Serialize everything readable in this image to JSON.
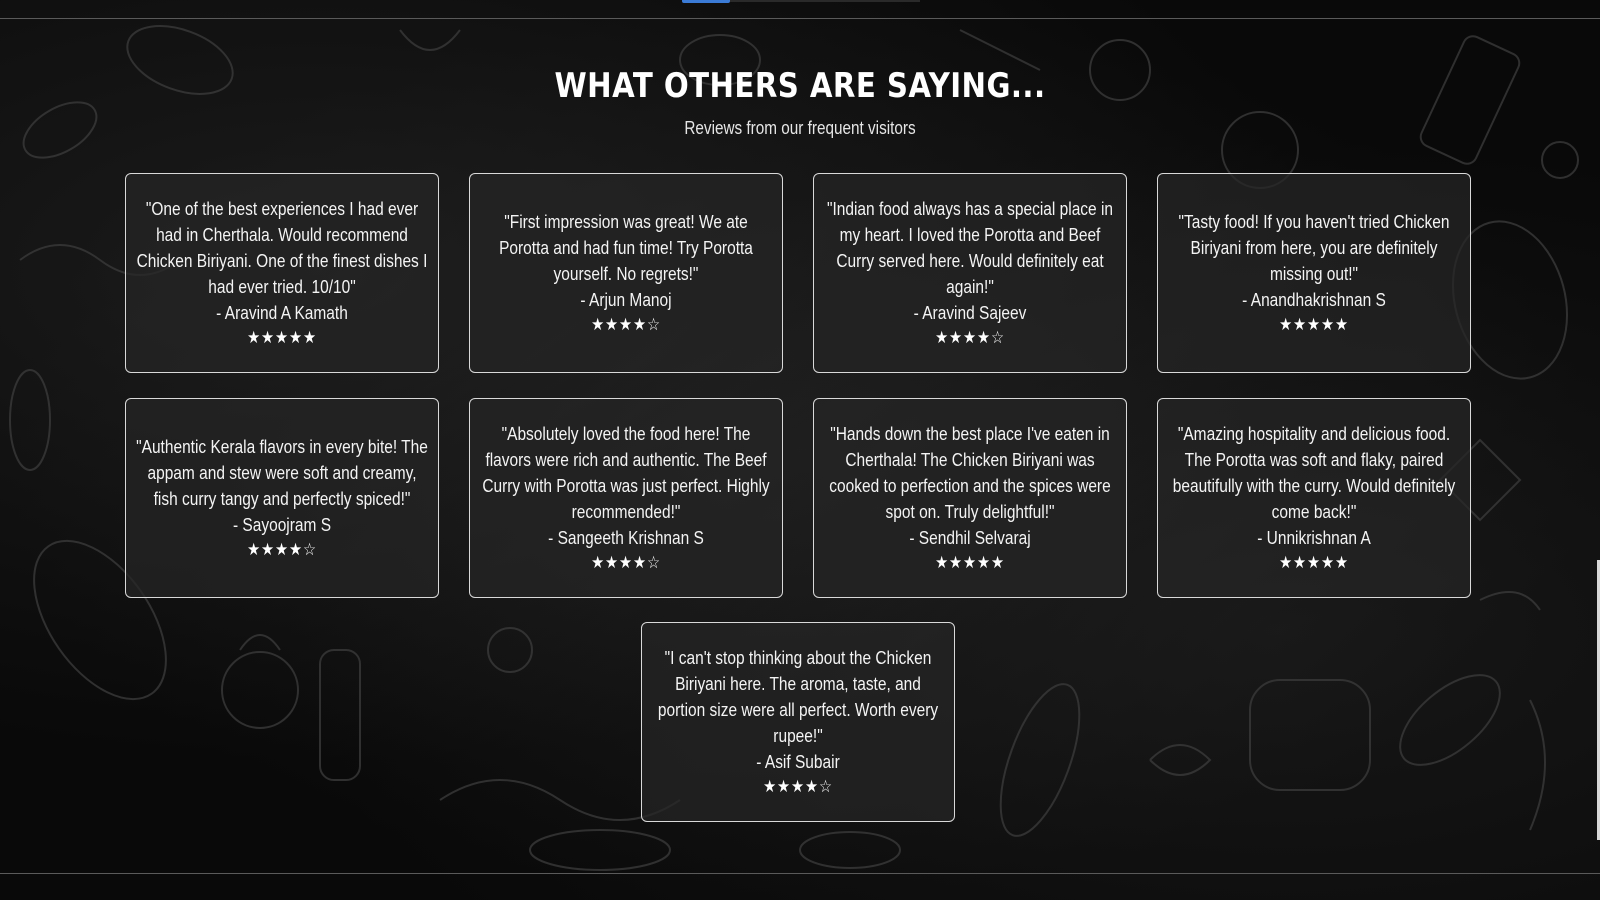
{
  "section": {
    "title": "WHAT OTHERS ARE SAYING...",
    "subtitle": "Reviews from our frequent visitors"
  },
  "reviews": [
    {
      "quote": "\"One of the best experiences I had ever had in Cherthala. Would recommend Chicken Biriyani. One of the finest dishes I had ever tried. 10/10\"",
      "author": "- Aravind A Kamath",
      "stars": "★★★★★"
    },
    {
      "quote": "\"First impression was great! We ate Porotta and had fun time! Try Porotta yourself. No regrets!\"",
      "author": "- Arjun Manoj",
      "stars": "★★★★☆"
    },
    {
      "quote": "\"Indian food always has a special place in my heart. I loved the Porotta and Beef Curry served here. Would definitely eat again!\"",
      "author": "- Aravind Sajeev",
      "stars": "★★★★☆"
    },
    {
      "quote": "\"Tasty food! If you haven't tried Chicken Biriyani from here, you are definitely missing out!\"",
      "author": "- Anandhakrishnan S",
      "stars": "★★★★★"
    },
    {
      "quote": "\"Authentic Kerala flavors in every bite! The appam and stew were soft and creamy, fish curry tangy and perfectly spiced!\"",
      "author": "- Sayoojram S",
      "stars": "★★★★☆"
    },
    {
      "quote": "\"Absolutely loved the food here! The flavors were rich and authentic. The Beef Curry with Porotta was just perfect. Highly recommended!\"",
      "author": "- Sangeeth Krishnan S",
      "stars": "★★★★☆"
    },
    {
      "quote": "\"Hands down the best place I've eaten in Cherthala! The Chicken Biriyani was cooked to perfection and the spices were spot on. Truly delightful!\"",
      "author": "- Sendhil Selvaraj",
      "stars": "★★★★★"
    },
    {
      "quote": "\"Amazing hospitality and delicious food. The Porotta was soft and flaky, paired beautifully with the curry. Would definitely come back!\"",
      "author": "- Unnikrishnan A",
      "stars": "★★★★★"
    },
    {
      "quote": "\"I can't stop thinking about the Chicken Biriyani here. The aroma, taste, and portion size were all perfect. Worth every rupee!\"",
      "author": "- Asif Subair",
      "stars": "★★★★☆"
    }
  ]
}
